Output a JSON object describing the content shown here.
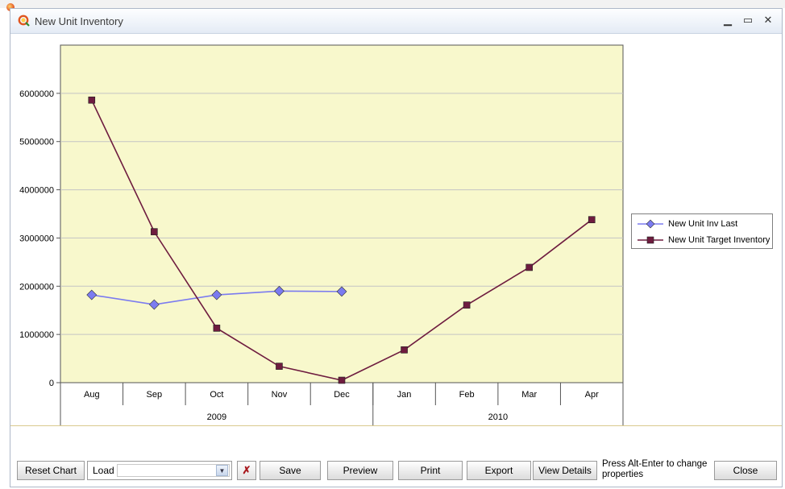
{
  "window": {
    "title": "New Unit Inventory",
    "controls": {
      "minimize": "▁",
      "maximize": "▭",
      "close": "✕"
    }
  },
  "chart_data": {
    "type": "line",
    "categories": [
      "Aug",
      "Sep",
      "Oct",
      "Nov",
      "Dec",
      "Jan",
      "Feb",
      "Mar",
      "Apr"
    ],
    "groups": [
      {
        "label": "2009",
        "span": 5
      },
      {
        "label": "2010",
        "span": 4
      }
    ],
    "ylim": [
      0,
      7000000
    ],
    "yticks": [
      0,
      1000000,
      2000000,
      3000000,
      4000000,
      5000000,
      6000000
    ],
    "ytick_labels": [
      "0",
      "1000000",
      "2000000",
      "3000000",
      "4000000",
      "5000000",
      "6000000"
    ],
    "grid": true,
    "plot_background": "#f8f8cc",
    "legend_position": "right",
    "series": [
      {
        "name": "New Unit Inv Last",
        "color": "#7b7bf0",
        "marker": "diamond",
        "values": [
          1820000,
          1620000,
          1820000,
          1900000,
          1890000,
          null,
          null,
          null,
          null
        ]
      },
      {
        "name": "New Unit Target Inventory",
        "color": "#6e1c3f",
        "marker": "square",
        "values": [
          5860000,
          3130000,
          1130000,
          340000,
          50000,
          680000,
          1610000,
          2390000,
          3380000
        ]
      }
    ]
  },
  "toolbar": {
    "reset_chart": "Reset Chart",
    "load_label": "Load",
    "load_value": "",
    "save": "Save",
    "preview": "Preview",
    "print": "Print",
    "export": "Export",
    "view_details": "View Details",
    "hint": "Press Alt-Enter to change properties",
    "close": "Close"
  },
  "icons": {
    "app": "qlik-q-icon",
    "dropdown": "chevron-down-icon",
    "clear": "clear-selection-icon"
  }
}
